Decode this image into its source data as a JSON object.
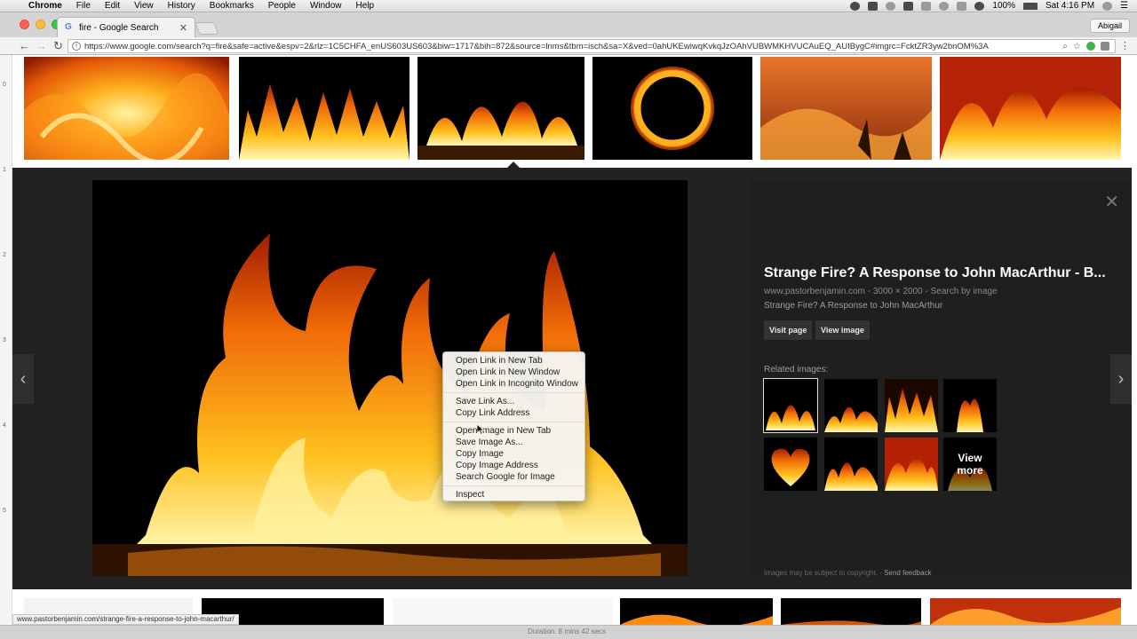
{
  "menubar": {
    "app": "Chrome",
    "items": [
      "File",
      "Edit",
      "View",
      "History",
      "Bookmarks",
      "People",
      "Window",
      "Help"
    ],
    "battery": "100%",
    "clock": "Sat 4:16 PM",
    "status_icons": [
      "media-icon",
      "camera-icon",
      "sync-icon",
      "dropbox-icon",
      "upload-icon",
      "time-machine-icon",
      "bluetooth-icon",
      "wifi-icon",
      "battery-icon",
      "search-icon",
      "menu-icon"
    ]
  },
  "browser": {
    "tab_title": "fire - Google Search",
    "favicon": "G",
    "profile": "Abigail",
    "url": "https://www.google.com/search?q=fire&safe=active&espv=2&rlz=1C5CHFA_enUS603US603&biw=1717&bih=872&source=lnms&tbm=isch&sa=X&ved=0ahUKEwiwqKvkqJzOAhVUBWMKHVUCAuEQ_AUIBygC#imgrc=FcktZR3yw2bnOM%3A"
  },
  "ruler": [
    "0",
    "1",
    "2",
    "3",
    "4",
    "5"
  ],
  "viewer": {
    "title": "Strange Fire? A Response to John MacArthur - B...",
    "site": "www.pastorbenjamin.com",
    "dims": "3000 × 2000",
    "search_by_image": "Search by image",
    "description": "Strange Fire? A Response to John MacArthur",
    "visit_page": "Visit page",
    "view_image": "View image",
    "related_label": "Related images:",
    "view_more_1": "View",
    "view_more_2": "more",
    "copyright_note": "Images may be subject to copyright.",
    "send_feedback": "Send feedback",
    "close_glyph": "✕",
    "prev_glyph": "‹",
    "next_glyph": "›"
  },
  "context_menu": {
    "open_new_tab": "Open Link in New Tab",
    "open_new_window": "Open Link in New Window",
    "open_incognito": "Open Link in Incognito Window",
    "save_link": "Save Link As...",
    "copy_link": "Copy Link Address",
    "open_image_tab": "Open Image in New Tab",
    "save_image": "Save Image As...",
    "copy_image": "Copy Image",
    "copy_image_address": "Copy Image Address",
    "search_google": "Search Google for Image",
    "inspect": "Inspect"
  },
  "status_url": "www.pastorbenjamin.com/strange-fire-a-response-to-john-macarthur/",
  "recording": {
    "duration": "Duration: 8 mins 42 secs"
  },
  "colors": {
    "viewer_bg": "#222222",
    "fire_orange": "#ff8a00",
    "fire_yellow": "#ffd23a",
    "fire_red": "#c0280a"
  }
}
